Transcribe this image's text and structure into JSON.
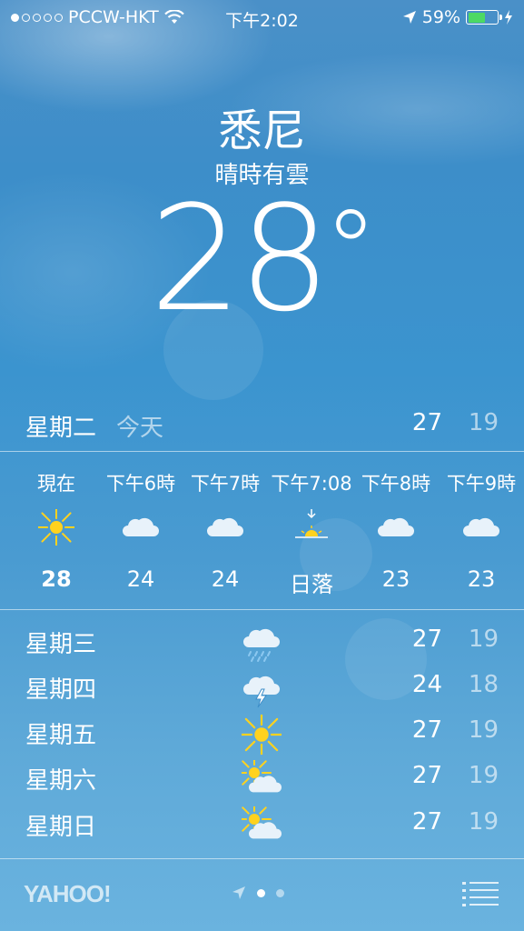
{
  "status_bar": {
    "carrier": "PCCW-HKT",
    "time": "下午2:02",
    "battery": "59%",
    "battery_level": 0.59,
    "signal_bars": 1
  },
  "location": {
    "city": "悉尼",
    "condition": "晴時有雲",
    "temperature": "28",
    "degree_symbol": "°"
  },
  "today": {
    "day": "星期二",
    "label": "今天",
    "high": "27",
    "low": "19"
  },
  "hourly": [
    {
      "time": "現在",
      "icon": "sun-icon",
      "value": "28"
    },
    {
      "time": "下午6時",
      "icon": "cloud-icon",
      "value": "24"
    },
    {
      "time": "下午7時",
      "icon": "cloud-icon",
      "value": "24"
    },
    {
      "time": "下午7:08",
      "icon": "sunset-icon",
      "value": "日落"
    },
    {
      "time": "下午8時",
      "icon": "cloud-icon",
      "value": "23"
    },
    {
      "time": "下午9時",
      "icon": "cloud-icon",
      "value": "23"
    }
  ],
  "daily": [
    {
      "day": "星期三",
      "icon": "rain-icon",
      "high": "27",
      "low": "19"
    },
    {
      "day": "星期四",
      "icon": "thunderstorm-icon",
      "high": "24",
      "low": "18"
    },
    {
      "day": "星期五",
      "icon": "sun-icon",
      "high": "27",
      "low": "19"
    },
    {
      "day": "星期六",
      "icon": "partly-cloudy-icon",
      "high": "27",
      "low": "19"
    },
    {
      "day": "星期日",
      "icon": "partly-cloudy-icon",
      "high": "27",
      "low": "19"
    }
  ],
  "footer": {
    "brand": "YAHOO!",
    "page_count": 2,
    "current_page": 1
  },
  "colors": {
    "sun": "#ffd21e",
    "battery": "#4cd964",
    "cloud": "#e8f2fa"
  }
}
